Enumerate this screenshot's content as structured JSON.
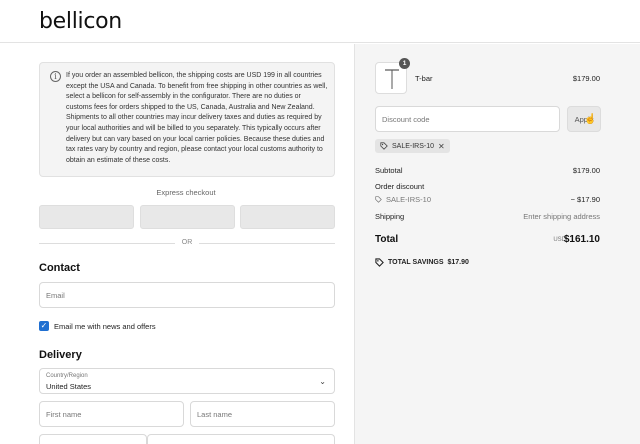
{
  "header": {
    "logo": "bellicon"
  },
  "notice": {
    "icon": "info-icon",
    "text": "If you order an assembled bellicon, the shipping costs are USD 199 in all countries except the USA and Canada. To benefit from free shipping in other countries as well, select a bellicon for self-assembly in the configurator. There are no duties or customs fees for orders shipped to the US, Canada, Australia and New Zealand. Shipments to all other countries may incur delivery taxes and duties as required by your local authorities and will be billed to you separately. This typically occurs after delivery but can vary based on your local carrier policies. Because these duties and tax rates vary by country and region, please contact your local customs authority to obtain an estimate of these costs."
  },
  "express": {
    "label": "Express checkout",
    "or": "OR"
  },
  "contact": {
    "title": "Contact",
    "email_placeholder": "Email",
    "newsletter_label": "Email me with news and offers",
    "newsletter_checked": true
  },
  "delivery": {
    "title": "Delivery",
    "country_label": "Country/Region",
    "country_value": "United States",
    "first_name_placeholder": "First name",
    "last_name_placeholder": "Last name"
  },
  "summary": {
    "product": {
      "name": "T-bar",
      "price": "$179.00",
      "quantity": "1"
    },
    "discount_placeholder": "Discount code",
    "apply_label": "Apply",
    "applied_code": "SALE-IRS-10",
    "subtotal_label": "Subtotal",
    "subtotal_value": "$179.00",
    "order_discount_label": "Order discount",
    "order_discount_code": "SALE-IRS-10",
    "order_discount_value": "− $17.90",
    "shipping_label": "Shipping",
    "shipping_value": "Enter shipping address",
    "total_label": "Total",
    "total_currency": "USD",
    "total_value": "$161.10",
    "savings_label": "TOTAL SAVINGS",
    "savings_value": "$17.90"
  }
}
